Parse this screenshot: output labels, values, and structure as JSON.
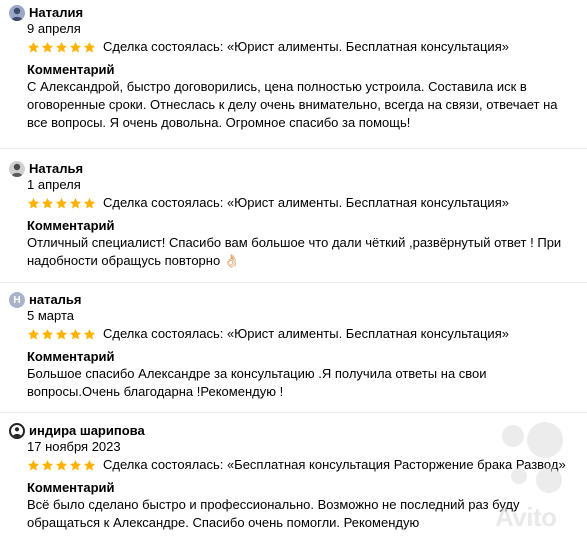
{
  "reviews": [
    {
      "author": "Наталия",
      "avatar_icon": "user-photo",
      "date": "9 апреля",
      "rating": 5,
      "deal": "Сделка состоялась: «Юрист алименты. Бесплатная консультация»",
      "comment_label": "Комментарий",
      "comment": "С Александрой, быстро договорились, цена полностью устроила. Составила иск в оговоренные сроки. Отнеслась к делу очень внимательно, всегда на связи, отвечает на все вопросы. Я очень довольна. Огромное спасибо за помощь!"
    },
    {
      "author": "Наталья",
      "avatar_icon": "user-photo",
      "date": "1 апреля",
      "rating": 5,
      "deal": "Сделка состоялась: «Юрист алименты. Бесплатная консультация»",
      "comment_label": "Комментарий",
      "comment": "Отличный специалист! Спасибо вам большое что дали чёткий ,развёрнутый ответ ! При надобности обращусь повторно 👌🏻"
    },
    {
      "author": "наталья",
      "avatar_letter": "Н",
      "date": "5 марта",
      "rating": 5,
      "deal": "Сделка состоялась: «Юрист алименты. Бесплатная консультация»",
      "comment_label": "Комментарий",
      "comment": "Большое спасибо Александре за консультацию .Я получила ответы на свои вопросы.Очень благодарна !Рекомендую !"
    },
    {
      "author": "индира шарипова",
      "avatar_icon": "user-icon",
      "date": "17 ноября 2023",
      "rating": 5,
      "deal": "Сделка состоялась: «Бесплатная консультация Расторжение брака Развод»",
      "comment_label": "Комментарий",
      "comment": "Всё было сделано быстро и профессионально. Возможно не последний раз буду обращаться к Александре. Спасибо очень помогли. Рекомендую"
    }
  ],
  "watermark": "Avito",
  "colors": {
    "star": "#ffb300",
    "divider": "#e9e9e9",
    "text": "#000000"
  }
}
